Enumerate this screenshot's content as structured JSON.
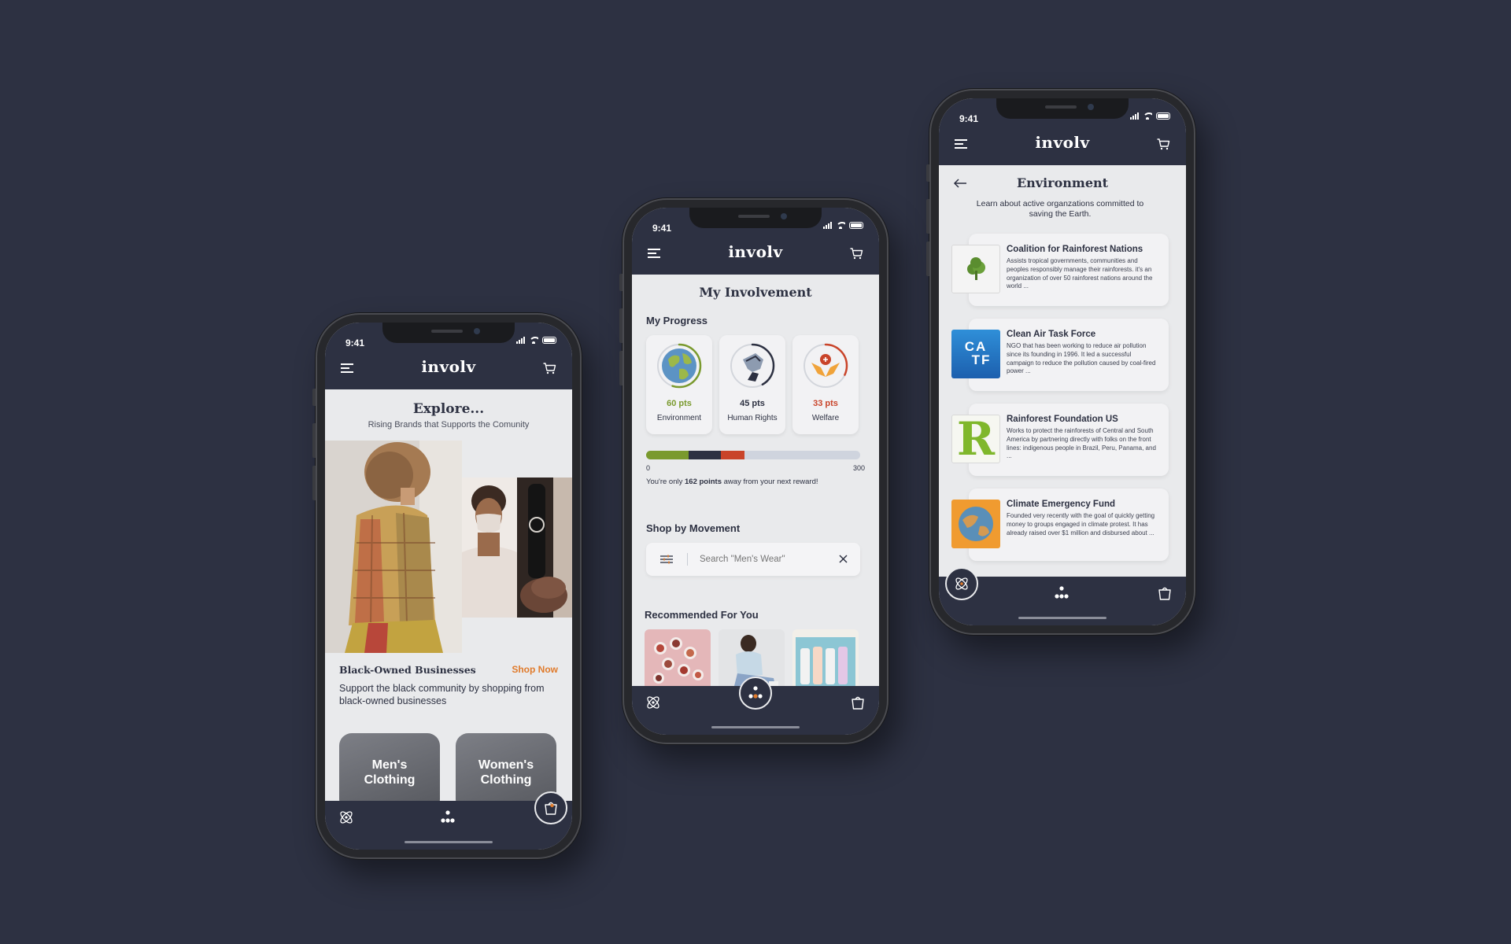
{
  "status_time": "9:41",
  "brand": "involv",
  "phone1": {
    "title": "Explore...",
    "subtitle": "Rising Brands that Supports the Comunity",
    "feature_title": "Black-Owned Businesses",
    "shop_now": "Shop Now",
    "feature_desc": "Support the black community by shopping from black-owned businesses",
    "categories": [
      "Men's Clothing",
      "Women's Clothing"
    ],
    "active_tab": "shop"
  },
  "phone2": {
    "title": "My Involvement",
    "progress_heading": "My Progress",
    "cards": [
      {
        "pts": "60 pts",
        "label": "Environment",
        "color": "#7a9a2e",
        "fraction": 0.55
      },
      {
        "pts": "45 pts",
        "label": "Human Rights",
        "color": "#2d3142",
        "fraction": 0.42
      },
      {
        "pts": "33 pts",
        "label": "Welfare",
        "color": "#c9442a",
        "fraction": 0.32
      }
    ],
    "bar": {
      "min": "0",
      "max": "300",
      "segments": [
        60,
        45,
        33
      ],
      "total": 300
    },
    "reward_text_prefix": "You're only ",
    "reward_points": "162 points",
    "reward_text_suffix": " away from your next reward!",
    "shop_heading": "Shop by Movement",
    "search_placeholder": "Search \"Men's Wear\"",
    "recommended_heading": "Recommended For You",
    "active_tab": "community"
  },
  "phone3": {
    "title": "Environment",
    "subtitle": "Learn about active organzations committed to saving the Earth.",
    "orgs": [
      {
        "name": "Coalition for Rainforest Nations",
        "desc": "Assists tropical governments, communities and peoples responsibly manage their rainforests. it's an organization of over 50 rainforest nations around the world ...",
        "logo": "tree-logo"
      },
      {
        "name": "Clean Air Task Force",
        "desc": "NGO that has been working to reduce air pollution since its founding in 1996. It led a successful campaign to reduce the pollution caused by coal-fired power ...",
        "logo_text_top": "CA",
        "logo_text_bottom": "TF",
        "logo": "catf-logo"
      },
      {
        "name": "Rainforest Foundation US",
        "desc": "Works to protect the rainforests of Central and South America by partnering directly with folks on the front lines: indigenous people in Brazil, Peru, Panama, and ...",
        "logo_text": "R",
        "logo": "r-logo"
      },
      {
        "name": "Climate Emergency Fund",
        "desc": "Founded very recently with the goal of quickly getting money to groups engaged in climate protest. It has already raised over $1 million and disbursed about ...",
        "logo": "globe-logo"
      }
    ],
    "active_tab": "impact"
  },
  "colors": {
    "navy": "#2d3142",
    "orange": "#e07b2c",
    "green": "#7a9a2e",
    "red": "#c9442a",
    "bg": "#2d3142"
  }
}
